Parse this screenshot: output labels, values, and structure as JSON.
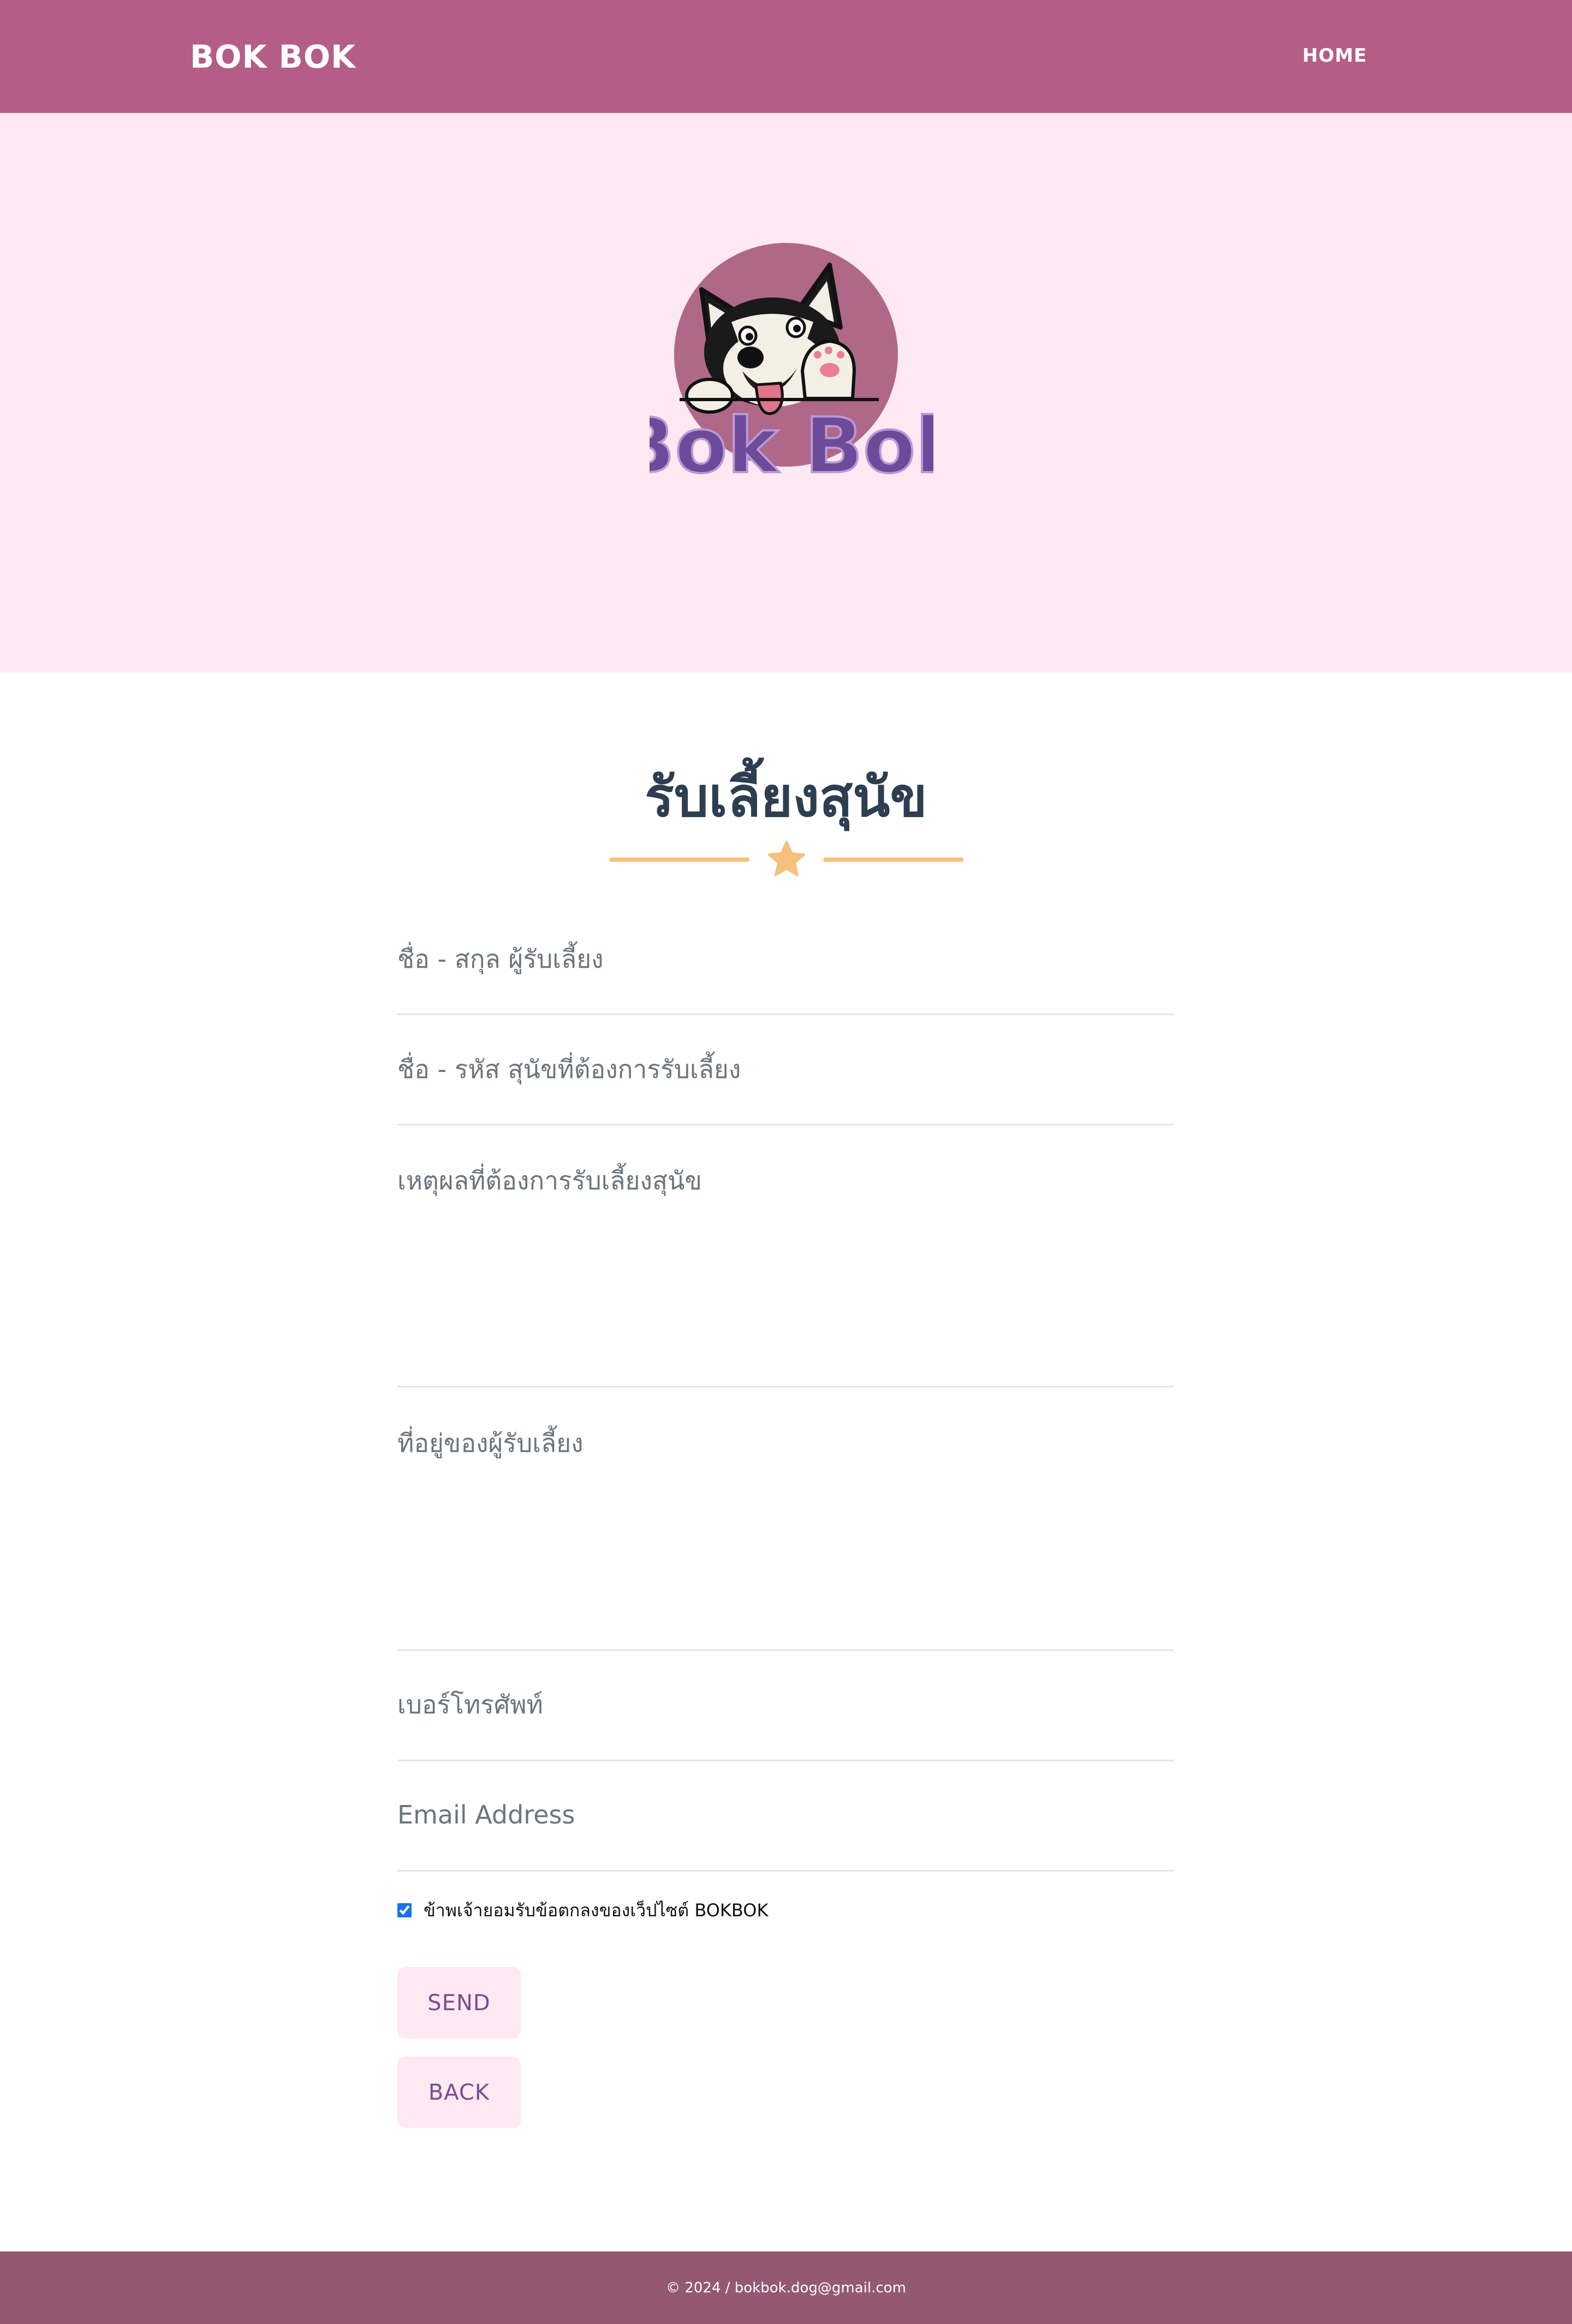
{
  "navbar": {
    "brand": "BOK BOK",
    "home_label": "HOME",
    "background": "#b45d87"
  },
  "hero": {
    "background": "#fde9f2",
    "logo_text": "Bok Bok",
    "logo_icon": "husky-dog-waving-icon"
  },
  "form": {
    "title": "รับเลี้ยงสุนัข",
    "divider_icon": "star-icon",
    "divider_color": "#f5c27d",
    "fields": {
      "owner_name": {
        "placeholder": "ชื่อ - สกุล ผู้รับเลี้ยง",
        "value": ""
      },
      "dog_name": {
        "placeholder": "ชื่อ - รหัส สุนัขที่ต้องการรับเลี้ยง",
        "value": ""
      },
      "reason": {
        "placeholder": "เหตุผลที่ต้องการรับเลี้ยงสุนัข",
        "value": ""
      },
      "address": {
        "placeholder": "ที่อยู่ของผู้รับเลี้ยง",
        "value": ""
      },
      "phone": {
        "placeholder": "เบอร์โทรศัพท์",
        "value": ""
      },
      "email": {
        "placeholder": "Email Address",
        "value": ""
      }
    },
    "terms": {
      "checked": true,
      "label": "ข้าพเจ้ายอมรับข้อตกลงของเว็ปไซต์ BOKBOK"
    },
    "send_label": "SEND",
    "back_label": "BACK"
  },
  "footer": {
    "text": "© 2024 / bokbok.dog@gmail.com",
    "background": "#945874"
  }
}
